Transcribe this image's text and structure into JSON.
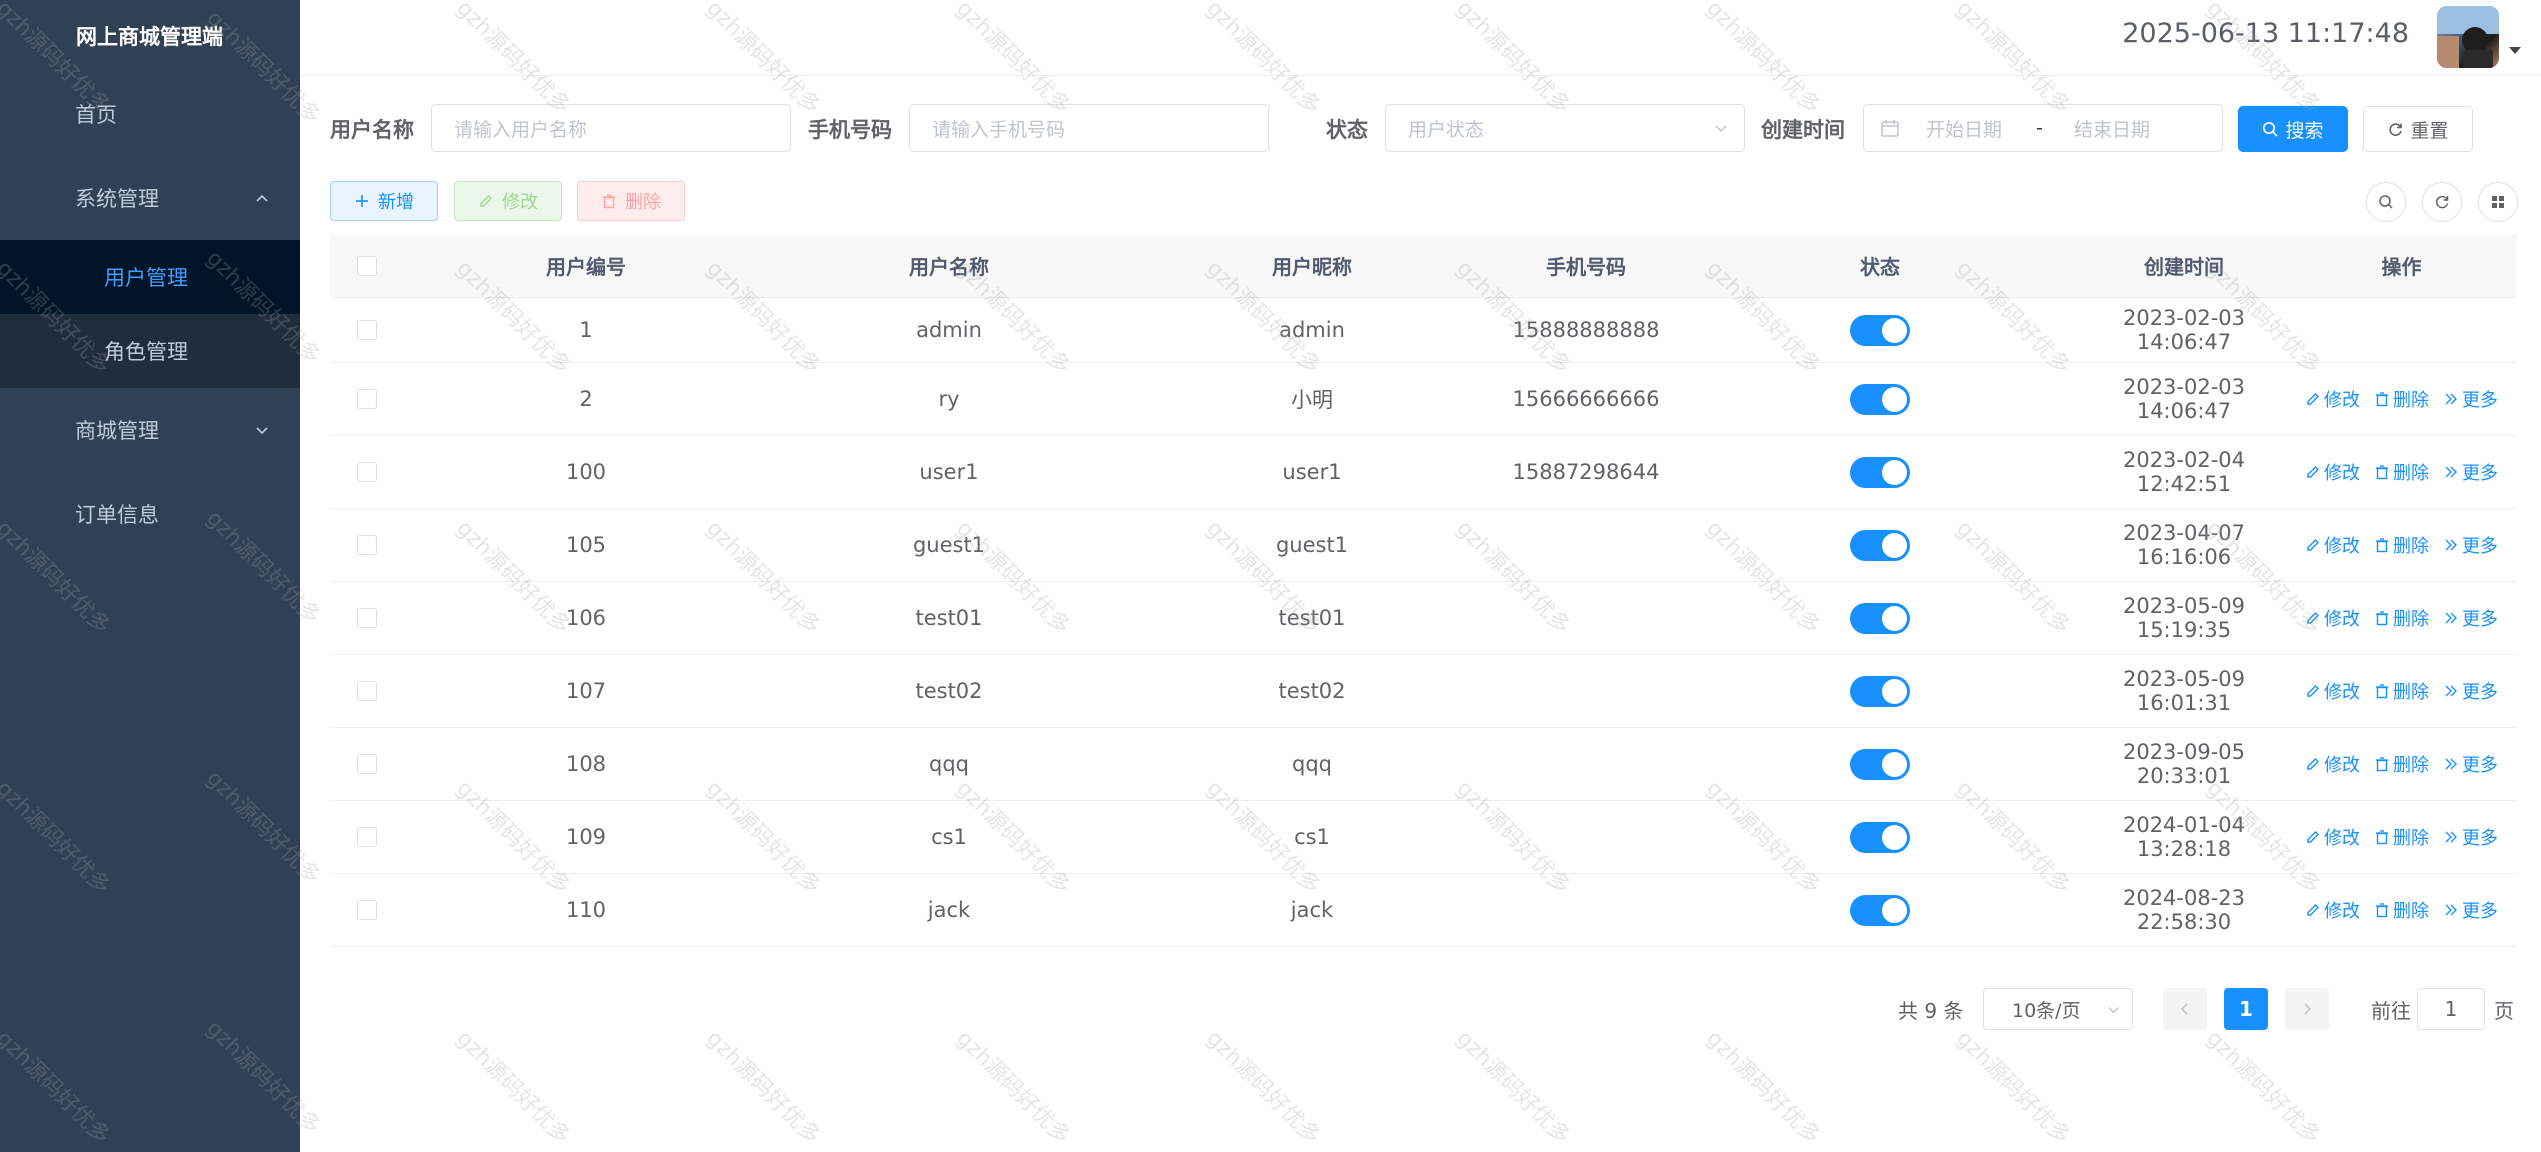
{
  "app": {
    "title": "网上商城管理端"
  },
  "sidebar": {
    "items": [
      {
        "label": "首页"
      },
      {
        "label": "系统管理",
        "children": [
          {
            "label": "用户管理",
            "active": true
          },
          {
            "label": "角色管理"
          }
        ]
      },
      {
        "label": "商城管理"
      },
      {
        "label": "订单信息"
      }
    ]
  },
  "header": {
    "datetime": "2025-06-13 11:17:48"
  },
  "search": {
    "username_label": "用户名称",
    "username_placeholder": "请输入用户名称",
    "phone_label": "手机号码",
    "phone_placeholder": "请输入手机号码",
    "status_label": "状态",
    "status_placeholder": "用户状态",
    "created_label": "创建时间",
    "start_placeholder": "开始日期",
    "date_sep": "-",
    "end_placeholder": "结束日期",
    "search_button": "搜索",
    "reset_button": "重置"
  },
  "toolbar": {
    "add": "新增",
    "edit": "修改",
    "delete": "删除"
  },
  "table": {
    "columns": [
      "用户编号",
      "用户名称",
      "用户昵称",
      "手机号码",
      "状态",
      "创建时间",
      "操作"
    ],
    "rows": [
      {
        "id": "1",
        "username": "admin",
        "nickname": "admin",
        "phone": "15888888888",
        "status": true,
        "created": "2023-02-03 14:06:47"
      },
      {
        "id": "2",
        "username": "ry",
        "nickname": "小明",
        "phone": "15666666666",
        "status": true,
        "created": "2023-02-03 14:06:47"
      },
      {
        "id": "100",
        "username": "user1",
        "nickname": "user1",
        "phone": "15887298644",
        "status": true,
        "created": "2023-02-04 12:42:51"
      },
      {
        "id": "105",
        "username": "guest1",
        "nickname": "guest1",
        "phone": "",
        "status": true,
        "created": "2023-04-07 16:16:06"
      },
      {
        "id": "106",
        "username": "test01",
        "nickname": "test01",
        "phone": "",
        "status": true,
        "created": "2023-05-09 15:19:35"
      },
      {
        "id": "107",
        "username": "test02",
        "nickname": "test02",
        "phone": "",
        "status": true,
        "created": "2023-05-09 16:01:31"
      },
      {
        "id": "108",
        "username": "qqq",
        "nickname": "qqq",
        "phone": "",
        "status": true,
        "created": "2023-09-05 20:33:01"
      },
      {
        "id": "109",
        "username": "cs1",
        "nickname": "cs1",
        "phone": "",
        "status": true,
        "created": "2024-01-04 13:28:18"
      },
      {
        "id": "110",
        "username": "jack",
        "nickname": "jack",
        "phone": "",
        "status": true,
        "created": "2024-08-23 22:58:30"
      }
    ],
    "row_actions": {
      "edit": "修改",
      "delete": "删除",
      "more": "更多"
    }
  },
  "pagination": {
    "total": "共 9 条",
    "page_size": "10条/页",
    "current_page": "1",
    "goto_prefix": "前往",
    "goto_value": "1",
    "goto_suffix": "页"
  },
  "watermark": "gzh源码好优多",
  "colors": {
    "primary": "#1890ff",
    "sidebar_bg": "#304156",
    "sidebar_active_bg": "#001528",
    "submenu_bg": "#1f2d3d"
  }
}
